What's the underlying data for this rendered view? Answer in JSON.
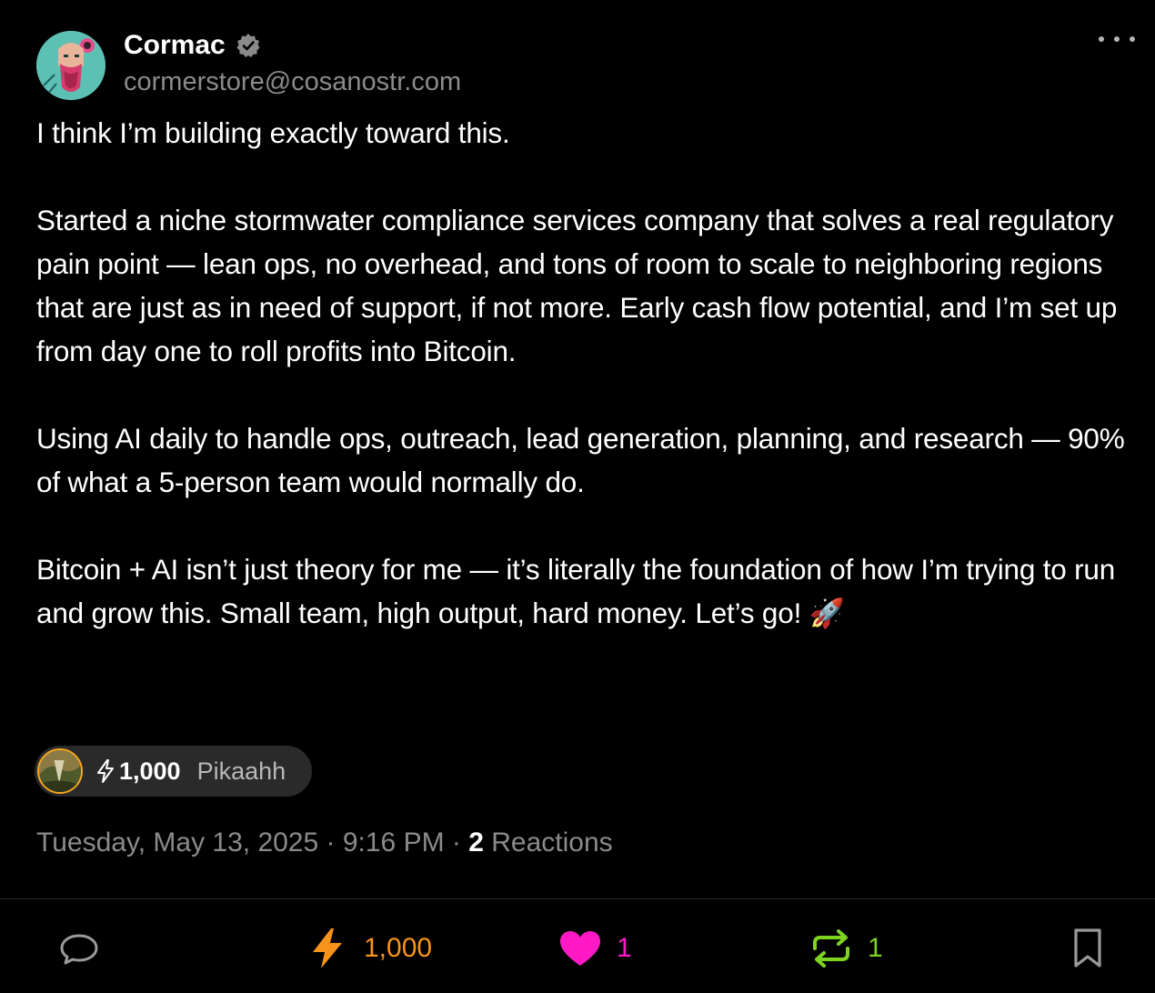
{
  "author": {
    "name": "Cormac",
    "handle": "cormerstore@cosanostr.com",
    "verified": true
  },
  "post": {
    "paragraphs": [
      "I think I’m building exactly toward this.",
      "Started a niche stormwater compliance services company that solves a real regulatory pain point — lean ops, no overhead, and tons of room to scale to neighboring regions that are just as in need of support, if not more. Early cash flow potential, and I’m set up from day one to roll profits into Bitcoin.",
      "Using AI daily to handle ops, outreach, lead generation, planning, and research — 90% of what a 5-person team would normally do.",
      "Bitcoin + AI isn’t just theory for me — it’s literally the foundation of how I’m trying to run and grow this. Small team, high output, hard money. Let’s go! 🚀"
    ]
  },
  "top_zap": {
    "amount": "1,000",
    "zapper_name": "Pikaahh"
  },
  "meta": {
    "timestamp": "Tuesday, May 13, 2025 · 9:16 PM · ",
    "reactions_count": "2",
    "reactions_label": " Reactions"
  },
  "actions": {
    "zap_count": "1,000",
    "like_count": "1",
    "repost_count": "1"
  },
  "colors": {
    "zap": "#f7931a",
    "like": "#ff1ac6",
    "repost": "#7ed321",
    "muted_text": "#8b8b8b"
  },
  "icons": [
    "chat-bubble-icon",
    "lightning-bolt-icon",
    "heart-icon",
    "repost-icon",
    "bookmark-icon",
    "verified-badge-icon",
    "more-dots-icon"
  ]
}
